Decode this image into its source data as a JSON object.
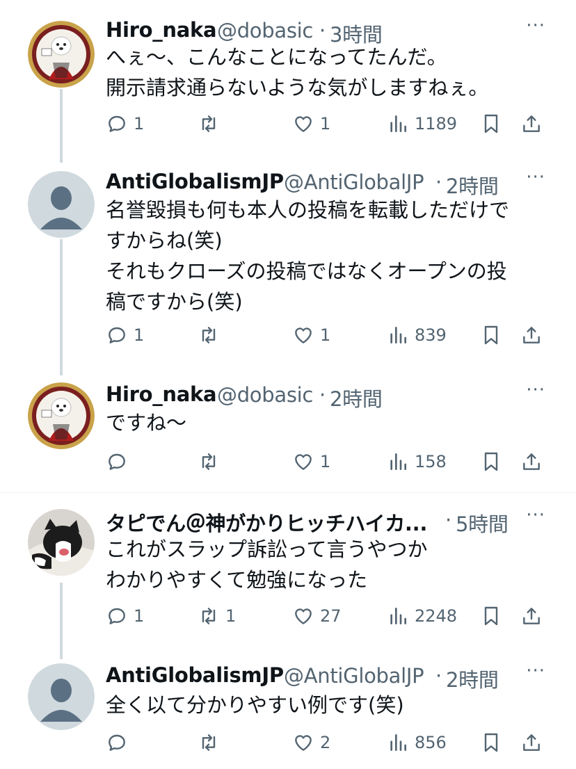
{
  "tweets": [
    {
      "name": "Hiro_naka",
      "handle": "@dobasic",
      "time": "3時間",
      "lines": [
        "へぇ〜、こんなことになってたんだ。",
        "開示請求通らないような気がしますねぇ。"
      ],
      "replies": "1",
      "retweets": "",
      "likes": "1",
      "views": "1189",
      "avatar": "bear-mascot-avatar"
    },
    {
      "name": "AntiGlobalismJP",
      "handle": "@AntiGlobalJP",
      "time": "2時間",
      "lines": [
        "名誉毀損も何も本人の投稿を転載しただけで",
        "すからね(笑)",
        "それもクローズの投稿ではなくオープンの投",
        "稿ですから(笑)"
      ],
      "replies": "1",
      "retweets": "",
      "likes": "1",
      "views": "839",
      "avatar": "default-avatar"
    },
    {
      "name": "Hiro_naka",
      "handle": "@dobasic",
      "time": "2時間",
      "lines": [
        "ですね〜"
      ],
      "replies": "",
      "retweets": "",
      "likes": "1",
      "views": "158",
      "avatar": "bear-mascot-avatar"
    },
    {
      "name": "タピでん＠神がかりヒッチハイカ...",
      "handle": "",
      "time": "5時間",
      "lines": [
        "これがスラップ訴訟って言うやつか",
        "わかりやすくて勉強になった"
      ],
      "replies": "1",
      "retweets": "1",
      "likes": "27",
      "views": "2248",
      "avatar": "cat-avatar"
    },
    {
      "name": "AntiGlobalismJP",
      "handle": "@AntiGlobalJP",
      "time": "2時間",
      "lines": [
        "全く以て分かりやすい例です(笑)"
      ],
      "replies": "",
      "retweets": "",
      "likes": "2",
      "views": "856",
      "avatar": "default-avatar"
    }
  ],
  "ui": {
    "separator": "·",
    "more": "···"
  },
  "colors": {
    "text": "#0f1419",
    "secondary": "#536471",
    "thread_line": "#cfd9de",
    "divider": "#eff3f4"
  }
}
